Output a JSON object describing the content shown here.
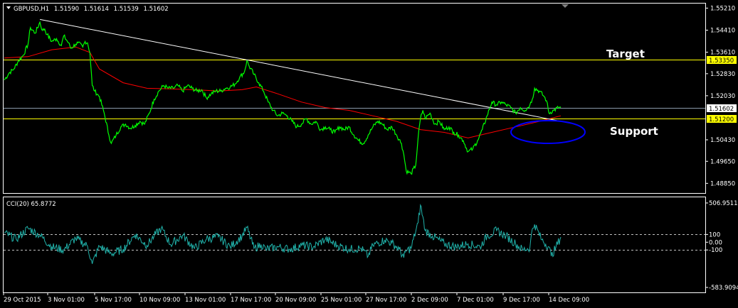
{
  "chart_data": [
    {
      "type": "line",
      "symbol": "GBPUSD,H1",
      "ohlc": {
        "open": "1.51590",
        "high": "1.51614",
        "low": "1.51539",
        "close": "1.51602"
      },
      "ylim": [
        1.4855,
        1.5535
      ],
      "y_tick_labels": [
        "1.55210",
        "1.54410",
        "1.53610",
        "1.52830",
        "1.52030",
        "1.50430",
        "1.49650",
        "1.48850"
      ],
      "x_tick_labels": [
        "29 Oct 2015",
        "3 Nov 01:00",
        "5 Nov 17:00",
        "10 Nov 09:00",
        "13 Nov 01:00",
        "17 Nov 17:00",
        "20 Nov 09:00",
        "25 Nov 01:00",
        "27 Nov 17:00",
        "2 Dec 09:00",
        "7 Dec 01:00",
        "9 Dec 17:00",
        "14 Dec 09:00"
      ],
      "price_series": [
        [
          0,
          1.526
        ],
        [
          2,
          1.5285
        ],
        [
          4,
          1.53
        ],
        [
          6,
          1.533
        ],
        [
          8,
          1.535
        ],
        [
          10,
          1.539
        ],
        [
          11,
          1.545
        ],
        [
          13,
          1.543
        ],
        [
          15,
          1.547
        ],
        [
          16,
          1.544
        ],
        [
          17,
          1.5445
        ],
        [
          18,
          1.5425
        ],
        [
          20,
          1.54
        ],
        [
          22,
          1.541
        ],
        [
          24,
          1.5385
        ],
        [
          25,
          1.542
        ],
        [
          27,
          1.5395
        ],
        [
          28,
          1.5375
        ],
        [
          30,
          1.539
        ],
        [
          31,
          1.5395
        ],
        [
          33,
          1.538
        ],
        [
          34,
          1.54
        ],
        [
          35,
          1.5395
        ],
        [
          36,
          1.536
        ],
        [
          37,
          1.524
        ],
        [
          38,
          1.522
        ],
        [
          40,
          1.52
        ],
        [
          42,
          1.514
        ],
        [
          44,
          1.506
        ],
        [
          45,
          1.503
        ],
        [
          47,
          1.506
        ],
        [
          49,
          1.509
        ],
        [
          51,
          1.51
        ],
        [
          53,
          1.5085
        ],
        [
          55,
          1.5095
        ],
        [
          57,
          1.511
        ],
        [
          59,
          1.51
        ],
        [
          61,
          1.514
        ],
        [
          63,
          1.519
        ],
        [
          65,
          1.522
        ],
        [
          67,
          1.524
        ],
        [
          69,
          1.523
        ],
        [
          71,
          1.523
        ],
        [
          73,
          1.524
        ],
        [
          75,
          1.522
        ],
        [
          77,
          1.524
        ],
        [
          79,
          1.523
        ],
        [
          81,
          1.522
        ],
        [
          83,
          1.5225
        ],
        [
          85,
          1.5195
        ],
        [
          87,
          1.521
        ],
        [
          89,
          1.522
        ],
        [
          91,
          1.522
        ],
        [
          93,
          1.523
        ],
        [
          95,
          1.5235
        ],
        [
          97,
          1.5245
        ],
        [
          99,
          1.527
        ],
        [
          101,
          1.529
        ],
        [
          102,
          1.533
        ],
        [
          103,
          1.531
        ],
        [
          105,
          1.528
        ],
        [
          107,
          1.525
        ],
        [
          109,
          1.522
        ],
        [
          111,
          1.518
        ],
        [
          113,
          1.515
        ],
        [
          115,
          1.513
        ],
        [
          117,
          1.514
        ],
        [
          119,
          1.513
        ],
        [
          121,
          1.511
        ],
        [
          123,
          1.509
        ],
        [
          125,
          1.51
        ],
        [
          127,
          1.512
        ],
        [
          129,
          1.51
        ],
        [
          131,
          1.511
        ],
        [
          133,
          1.508
        ],
        [
          135,
          1.509
        ],
        [
          137,
          1.508
        ],
        [
          139,
          1.507
        ],
        [
          141,
          1.509
        ],
        [
          143,
          1.508
        ],
        [
          145,
          1.509
        ],
        [
          147,
          1.506
        ],
        [
          149,
          1.504
        ],
        [
          151,
          1.503
        ],
        [
          153,
          1.506
        ],
        [
          155,
          1.509
        ],
        [
          157,
          1.511
        ],
        [
          159,
          1.51
        ],
        [
          161,
          1.508
        ],
        [
          163,
          1.509
        ],
        [
          165,
          1.506
        ],
        [
          167,
          1.503
        ],
        [
          168,
          1.499
        ],
        [
          169,
          1.493
        ],
        [
          171,
          1.492
        ],
        [
          173,
          1.495
        ],
        [
          174,
          1.505
        ],
        [
          175,
          1.512
        ],
        [
          176,
          1.515
        ],
        [
          177,
          1.512
        ],
        [
          179,
          1.514
        ],
        [
          181,
          1.51
        ],
        [
          183,
          1.511
        ],
        [
          185,
          1.508
        ],
        [
          187,
          1.509
        ],
        [
          189,
          1.507
        ],
        [
          191,
          1.506
        ],
        [
          193,
          1.504
        ],
        [
          195,
          1.5
        ],
        [
          197,
          1.501
        ],
        [
          199,
          1.504
        ],
        [
          201,
          1.508
        ],
        [
          203,
          1.513
        ],
        [
          205,
          1.518
        ],
        [
          207,
          1.517
        ],
        [
          209,
          1.518
        ],
        [
          211,
          1.517
        ],
        [
          213,
          1.516
        ],
        [
          215,
          1.514
        ],
        [
          217,
          1.516
        ],
        [
          219,
          1.515
        ],
        [
          221,
          1.517
        ],
        [
          222,
          1.519
        ],
        [
          223,
          1.523
        ],
        [
          225,
          1.522
        ],
        [
          227,
          1.52
        ],
        [
          228,
          1.5185
        ],
        [
          229,
          1.514
        ],
        [
          231,
          1.515
        ],
        [
          233,
          1.516
        ],
        [
          234,
          1.516
        ]
      ],
      "ma_series": [
        [
          0,
          1.534
        ],
        [
          10,
          1.5345
        ],
        [
          20,
          1.537
        ],
        [
          30,
          1.538
        ],
        [
          36,
          1.536
        ],
        [
          40,
          1.53
        ],
        [
          50,
          1.525
        ],
        [
          60,
          1.523
        ],
        [
          70,
          1.5228
        ],
        [
          80,
          1.5225
        ],
        [
          90,
          1.522
        ],
        [
          100,
          1.5225
        ],
        [
          106,
          1.5235
        ],
        [
          115,
          1.521
        ],
        [
          125,
          1.518
        ],
        [
          135,
          1.516
        ],
        [
          145,
          1.515
        ],
        [
          155,
          1.513
        ],
        [
          165,
          1.511
        ],
        [
          175,
          1.508
        ],
        [
          185,
          1.507
        ],
        [
          195,
          1.505
        ],
        [
          205,
          1.507
        ],
        [
          215,
          1.509
        ],
        [
          225,
          1.511
        ],
        [
          234,
          1.513
        ]
      ],
      "trendline": [
        [
          15,
          1.548
        ],
        [
          240,
          1.51
        ]
      ],
      "horizontal_lines": [
        {
          "price": 1.5335,
          "label": "1.53350",
          "color": "#ffff00"
        },
        {
          "price": 1.512,
          "label": "1.51200",
          "color": "#ffff00"
        },
        {
          "price": 1.51602,
          "label": "1.51602",
          "color": "#8b9aab"
        }
      ],
      "annotations": {
        "target": "Target",
        "support": "Support"
      },
      "colors": {
        "price": "#00ff00",
        "ma": "#ff0000",
        "trend": "#ffffff",
        "ellipse": "#0000ff",
        "hline": "#ffff00",
        "current": "#8b9aab"
      }
    },
    {
      "type": "line",
      "title": "CCI(20) 65.8772",
      "ylim": [
        -583.9094,
        506.9511
      ],
      "y_tick_labels": [
        "506.9511",
        "100",
        "0.00",
        "-100",
        "-583.9094"
      ],
      "levels": [
        100,
        -100
      ],
      "series": [
        [
          0,
          120
        ],
        [
          5,
          40
        ],
        [
          10,
          180
        ],
        [
          15,
          90
        ],
        [
          20,
          -60
        ],
        [
          25,
          -100
        ],
        [
          30,
          50
        ],
        [
          35,
          -50
        ],
        [
          37,
          -280
        ],
        [
          40,
          -50
        ],
        [
          45,
          -150
        ],
        [
          50,
          -90
        ],
        [
          55,
          100
        ],
        [
          60,
          -40
        ],
        [
          63,
          80
        ],
        [
          66,
          180
        ],
        [
          70,
          -30
        ],
        [
          75,
          90
        ],
        [
          80,
          -80
        ],
        [
          85,
          40
        ],
        [
          90,
          70
        ],
        [
          95,
          -60
        ],
        [
          100,
          80
        ],
        [
          102,
          190
        ],
        [
          105,
          -80
        ],
        [
          108,
          -30
        ],
        [
          110,
          -90
        ],
        [
          115,
          -60
        ],
        [
          120,
          -90
        ],
        [
          125,
          -40
        ],
        [
          130,
          -60
        ],
        [
          135,
          40
        ],
        [
          140,
          -40
        ],
        [
          145,
          -90
        ],
        [
          150,
          -80
        ],
        [
          153,
          -180
        ],
        [
          155,
          -40
        ],
        [
          160,
          30
        ],
        [
          163,
          -10
        ],
        [
          166,
          -90
        ],
        [
          168,
          -200
        ],
        [
          169,
          -110
        ],
        [
          171,
          -80
        ],
        [
          174,
          250
        ],
        [
          175,
          480
        ],
        [
          177,
          150
        ],
        [
          180,
          80
        ],
        [
          185,
          -20
        ],
        [
          190,
          -60
        ],
        [
          195,
          -20
        ],
        [
          200,
          -60
        ],
        [
          203,
          80
        ],
        [
          207,
          150
        ],
        [
          211,
          80
        ],
        [
          215,
          -20
        ],
        [
          218,
          -100
        ],
        [
          221,
          -70
        ],
        [
          222,
          170
        ],
        [
          223,
          230
        ],
        [
          226,
          30
        ],
        [
          229,
          -60
        ],
        [
          230,
          -180
        ],
        [
          232,
          -60
        ],
        [
          234,
          66
        ]
      ],
      "colors": {
        "line": "#20b2aa",
        "level": "#c0c0c0"
      }
    }
  ]
}
